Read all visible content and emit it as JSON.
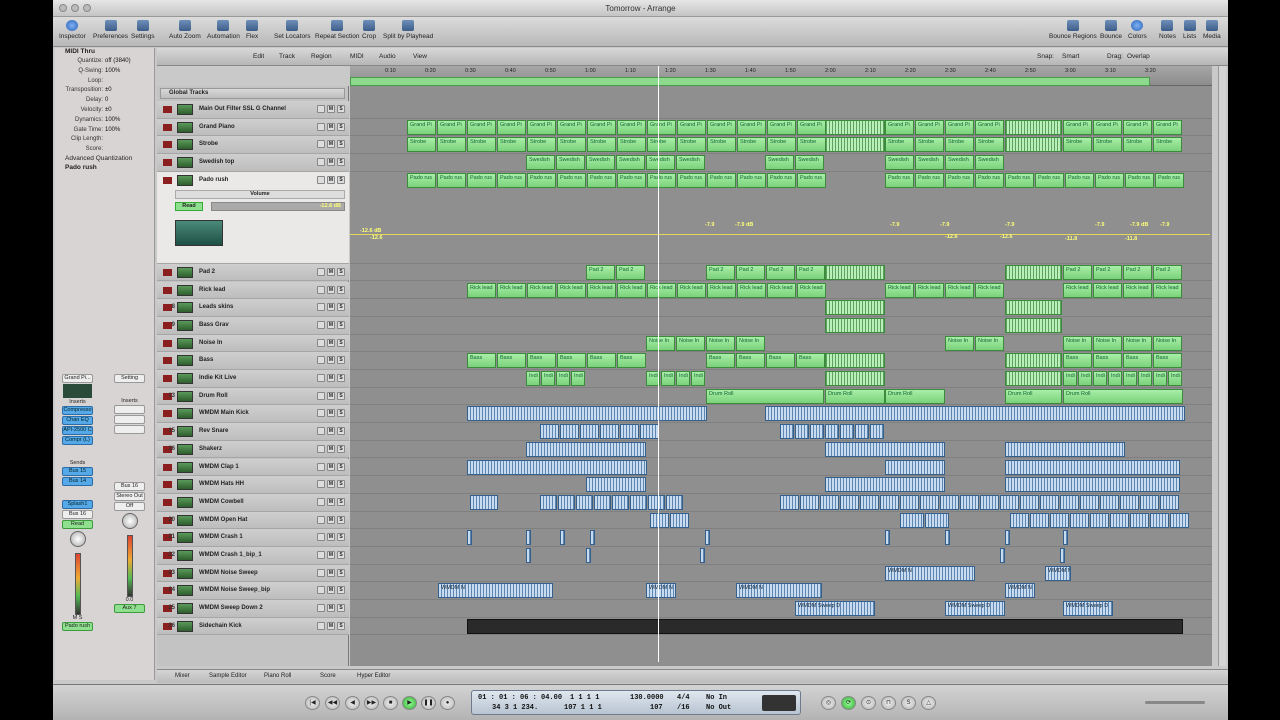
{
  "window": {
    "title": "Tomorrow - Arrange"
  },
  "toolbar": {
    "left": [
      "Inspector",
      "Preferences",
      "Settings"
    ],
    "mid": [
      "Auto Zoom",
      "Automation",
      "Flex",
      "Set Locators",
      "Repeat Section",
      "Crop",
      "Split by Playhead"
    ],
    "right": [
      "Bounce Regions",
      "Bounce",
      "Colors",
      "Notes",
      "Lists",
      "Media"
    ]
  },
  "local_menus": [
    "Edit",
    "Track",
    "Region",
    "MIDI",
    "Audio",
    "View"
  ],
  "snap": {
    "label": "Snap:",
    "value": "Smart",
    "drag_label": "Drag:",
    "drag_value": "Overlap"
  },
  "inspector": {
    "header": "MIDI Thru",
    "params": [
      {
        "k": "Quantize:",
        "v": "off (3840)"
      },
      {
        "k": "Q-Swing:",
        "v": "100%"
      },
      {
        "k": "Loop:",
        "v": ""
      },
      {
        "k": "Transposition:",
        "v": "±0"
      },
      {
        "k": "Delay:",
        "v": "0"
      },
      {
        "k": "Velocity:",
        "v": "±0"
      },
      {
        "k": "Dynamics:",
        "v": "100%"
      },
      {
        "k": "Gate Time:",
        "v": "100%"
      },
      {
        "k": "Clip Length:",
        "v": ""
      },
      {
        "k": "Score:",
        "v": ""
      }
    ],
    "advanced": "Advanced Quantization",
    "region_name": "Pado rush",
    "strip1": {
      "name": "Grand Pi...",
      "inserts_label": "Inserts",
      "inserts": [
        "Compresso",
        "Chan EQ",
        "API-2500 C",
        "Compr (L)"
      ],
      "sends_label": "Sends",
      "sends": [
        "Bus 15",
        "Bus 14"
      ],
      "io": [
        "Splash1",
        "Bus 16"
      ],
      "mode": "Read",
      "mute_solo": "M S",
      "name_bottom": "Pado rush"
    },
    "strip2": {
      "name": "Setting",
      "inserts_label": "Inserts",
      "io": [
        "Bus 16",
        "Stereo Out"
      ],
      "mode": "Off",
      "name_bottom": "Aux 7",
      "value": "0.0"
    }
  },
  "global_tracks_label": "Global Tracks",
  "tracks": [
    {
      "n": "",
      "name": "Main Out Filter SSL G Channel"
    },
    {
      "n": "",
      "name": "Grand Piano"
    },
    {
      "n": "",
      "name": "Strobe"
    },
    {
      "n": "",
      "name": "Swedish top"
    },
    {
      "n": "",
      "name": "Pado rush"
    },
    {
      "n": "",
      "name": "Pad 2"
    },
    {
      "n": "",
      "name": "Rick lead"
    },
    {
      "n": "8",
      "name": "Leads skins"
    },
    {
      "n": "9",
      "name": "Bass Grav"
    },
    {
      "n": "",
      "name": "Noise In"
    },
    {
      "n": "",
      "name": "Bass"
    },
    {
      "n": "",
      "name": "Indie Kit Live"
    },
    {
      "n": "13",
      "name": "Drum Roll"
    },
    {
      "n": "",
      "name": "WMDM Main Kick"
    },
    {
      "n": "15",
      "name": "Rev Snare"
    },
    {
      "n": "16",
      "name": "Shakerz"
    },
    {
      "n": "",
      "name": "WMDM Clap 1"
    },
    {
      "n": "",
      "name": "WMDM Hats HH"
    },
    {
      "n": "",
      "name": "WMDM Cowbell"
    },
    {
      "n": "20",
      "name": "WMDM Open Hat"
    },
    {
      "n": "21",
      "name": "WMDM Crash 1"
    },
    {
      "n": "22",
      "name": "WMDM Crash 1_bip_1"
    },
    {
      "n": "23",
      "name": "WMDM Noise Sweep"
    },
    {
      "n": "24",
      "name": "WMDM Noise Sweep_bip"
    },
    {
      "n": "25",
      "name": "WMDM Sweep Down 2"
    },
    {
      "n": "26",
      "name": "Sidechain Kick"
    }
  ],
  "pado_rush": {
    "automation_label": "Volume",
    "mode": "Read",
    "level": "-12.6 dB"
  },
  "automation_values": [
    "-12.6 dB",
    "-12.6",
    "-7.9",
    "-7.9 dB",
    "-7.9",
    "-12.6",
    "-7.9",
    "-12.6",
    "-7.9",
    "-11.8",
    "-7.9",
    "-7.9 dB",
    "-11.8",
    "-7.9"
  ],
  "region_names": {
    "piano": "Grand Pi",
    "strobe": "Strobe",
    "swedish": "Swedish",
    "pado": "Pado rus",
    "pad2": "Pad 2",
    "rick": "Rick lead",
    "noise": "Noise In",
    "bass": "Bass",
    "indie": "Indi",
    "drumroll": "Drum Roll",
    "wmdm": "WMDM N",
    "sweep": "WMDM Sweep Dc",
    "sweepdown": "WMDM Sweep D"
  },
  "ruler_marks": [
    "0:10",
    "0:20",
    "0:30",
    "0:40",
    "0:50",
    "1:00",
    "1:10",
    "1:20",
    "1:30",
    "1:40",
    "1:50",
    "2:00",
    "2:10",
    "2:20",
    "2:30",
    "2:40",
    "2:50",
    "3:00",
    "3:10",
    "3:20"
  ],
  "bottom_tabs": [
    "Mixer",
    "Sample Editor",
    "Piano Roll",
    "Score",
    "Hyper Editor"
  ],
  "transport": {
    "smpte_top": "01 : 01 : 06 : 04.00",
    "bars_top": "1   1   1   1",
    "bpm": "130.0000",
    "sig_top": "4/4",
    "in": "No In",
    "smpte_bottom": "34   3   1   234.",
    "bars_bottom": "107   1   1   1",
    "pos_bottom": "107",
    "sig_bottom": "/16",
    "out": "No Out"
  }
}
